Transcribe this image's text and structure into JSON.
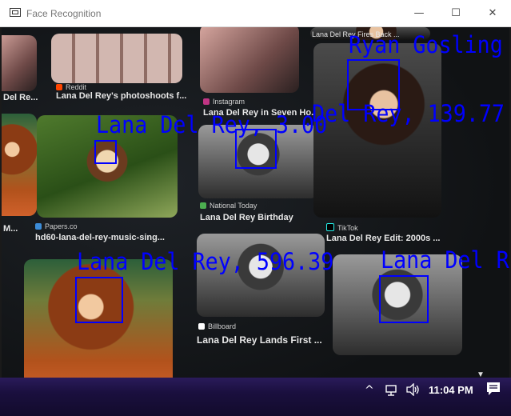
{
  "window": {
    "title": "Face Recognition",
    "controls": {
      "minimize": "—",
      "maximize": "☐",
      "close": "✕"
    }
  },
  "photo": {
    "cards": [
      {
        "source": "Reddit",
        "caption": "Lana Del Rey's photoshoots f..."
      },
      {
        "source": "Instagram",
        "caption": "Lana Del Rey in Seven Ho..."
      },
      {
        "source": "Papers.co",
        "caption": "hd60-lana-del-rey-music-sing..."
      },
      {
        "source": "National Today",
        "caption": "Lana Del Rey Birthday"
      },
      {
        "source": "TikTok",
        "caption": "Lana Del Rey Edit: 2000s ..."
      },
      {
        "source": "Billboard",
        "caption": "Lana Del Rey Lands First ..."
      },
      {
        "source": "",
        "caption": "Lana Del Rey Fires Back ..."
      },
      {
        "source": "",
        "caption": "Del Re..."
      },
      {
        "source": "",
        "caption": "M..."
      }
    ],
    "detections": [
      {
        "label": "Ryan Gosling"
      },
      {
        "label": "Lana Del Rey, 3.00"
      },
      {
        "label": "Del Rey, 139.77"
      },
      {
        "label": "Lana Del Rey, 596.39"
      },
      {
        "label": "Lana Del R"
      }
    ]
  },
  "taskbar": {
    "chevron": "^",
    "network_icon": "network-icon",
    "volume_icon": "volume-icon",
    "time": "11:04 PM",
    "notification_icon": "notification-icon"
  },
  "colors": {
    "detection": "#0000ff",
    "taskbar": "#1a0f3e"
  }
}
